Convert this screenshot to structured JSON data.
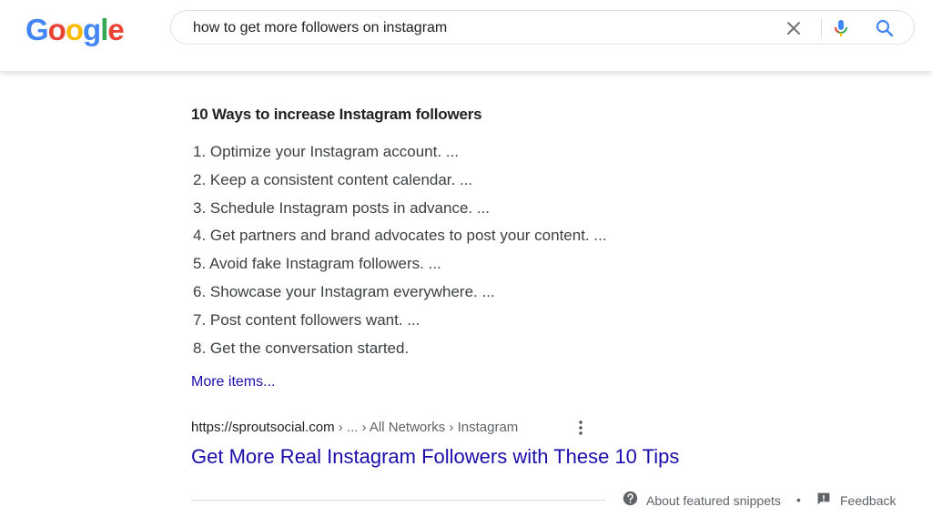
{
  "header": {
    "logo": {
      "letters": [
        "G",
        "o",
        "o",
        "g",
        "l",
        "e"
      ],
      "colors": [
        "#4285F4",
        "#EA4335",
        "#FBBC05",
        "#4285F4",
        "#34A853",
        "#EA4335"
      ]
    },
    "search": {
      "query": "how to get more followers on instagram",
      "clear_icon": "close-icon",
      "mic_icon": "microphone-icon",
      "search_icon": "search-icon"
    }
  },
  "snippet": {
    "title": "10 Ways to increase Instagram followers",
    "items": [
      "1. Optimize your Instagram account. ...",
      "2. Keep a consistent content calendar. ...",
      "3. Schedule Instagram posts in advance. ...",
      "4. Get partners and brand advocates to post your content. ...",
      "5. Avoid fake Instagram followers. ...",
      "6. Showcase your Instagram everywhere. ...",
      "7. Post content followers want. ...",
      "8. Get the conversation started."
    ],
    "more_items": "More items..."
  },
  "result": {
    "url": "https://sproutsocial.com",
    "breadcrumbs": " › ... › All Networks › Instagram",
    "title": "Get More Real Instagram Followers with These 10 Tips",
    "menu_icon": "more-vert-icon"
  },
  "footer": {
    "about_label": "About featured snippets",
    "separator": "•",
    "feedback_label": "Feedback",
    "about_icon": "help-icon",
    "feedback_icon": "feedback-icon"
  },
  "colors": {
    "link": "#1a0dab",
    "text": "#202124",
    "muted": "#5f6368"
  }
}
